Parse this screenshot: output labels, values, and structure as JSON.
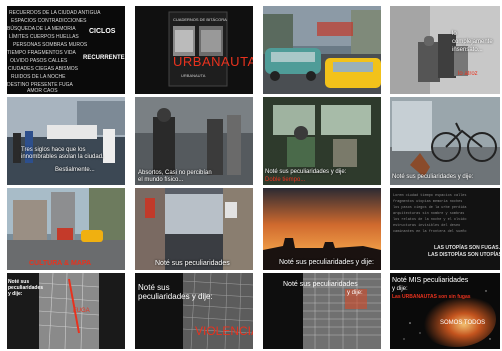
{
  "tiles": [
    {
      "caption": "CICLOS",
      "caption2": "RECURRENTES"
    },
    {
      "title": "URBANAUTA",
      "cover_top": "CUADERNOS DE BITÁCORA",
      "cover_sub": "URBANAUTA"
    },
    {
      "caption": ""
    },
    {
      "caption": "lo complejamente insensato...",
      "caption2": "lo atroz"
    },
    {
      "caption": "Tres siglos hace que los innombrables asolan la ciudad.",
      "caption2": "Bestialmente..."
    },
    {
      "caption": "Absortos,  Casi no percibían",
      "caption2": "el mundo físico..."
    },
    {
      "caption": "Noté sus peculiaridades y dije:",
      "caption2": "Doble tiempo..."
    },
    {
      "caption": "Noté sus peculiaridades y dije:"
    },
    {
      "caption": "CULTURA & MAPA"
    },
    {
      "caption": "Noté sus peculiaridades"
    },
    {
      "caption": "Noté sus peculiaridades y dije:"
    },
    {
      "caption": "LAS UTOPÍAS SON FUGAS.",
      "caption2": "LAS DISTOPÍAS SON UTOPÍAS"
    },
    {
      "caption": "Noté sus peculiaridades y dije:",
      "caption2": "FUGA"
    },
    {
      "caption": "Noté sus peculiaridades y dije:",
      "big": "VIOLENCIA"
    },
    {
      "caption": "Noté sus peculiaridades",
      "caption2": "y dije:"
    },
    {
      "caption": "Noté MIS peculiaridades",
      "caption2": "y dije:",
      "caption3": "Las URBANAUTAS son sin fugas",
      "caption4": "SOMOS TODOS"
    }
  ]
}
